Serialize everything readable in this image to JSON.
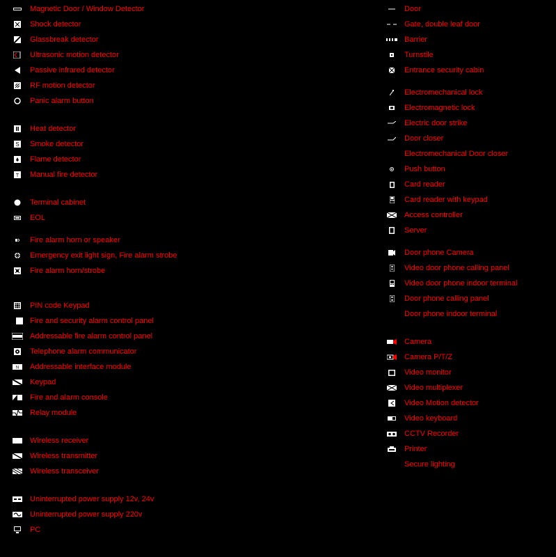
{
  "left": [
    {
      "icon": "magneticdoor",
      "label": "Magnetic Door / Window Detector"
    },
    {
      "icon": "shock",
      "label": "Shock detector"
    },
    {
      "icon": "glassbreak",
      "label": "Glassbreak detector"
    },
    {
      "icon": "ultrasonic",
      "label": "Ultrasonic motion detector"
    },
    {
      "icon": "pir",
      "label": "Passive infrared detector"
    },
    {
      "icon": "rfmotion",
      "label": "RF motion detector"
    },
    {
      "icon": "panic",
      "label": "Panic alarm button"
    },
    {
      "gap": "m"
    },
    {
      "icon": "heat",
      "label": "Heat detector"
    },
    {
      "icon": "smoke",
      "label": "Smoke detector"
    },
    {
      "icon": "flame",
      "label": "Flame detector"
    },
    {
      "icon": "manualfire",
      "label": "Manual fire detector"
    },
    {
      "gap": "m"
    },
    {
      "icon": "terminal",
      "label": "Terminal cabinet"
    },
    {
      "icon": "eol",
      "label": "EOL"
    },
    {
      "gap": "s"
    },
    {
      "icon": "horn",
      "label": "Fire alarm horn or speaker"
    },
    {
      "icon": "strobe",
      "label": "Emergency exit light sign, Fire alarm strobe"
    },
    {
      "icon": "hornstrobe",
      "label": "Fire alarm horn/strobe"
    },
    {
      "gap": "l"
    },
    {
      "icon": "pinkeypad",
      "label": "PIN code Keypad"
    },
    {
      "icon": "firesec",
      "label": "Fire and security alarm control panel"
    },
    {
      "icon": "addressable",
      "label": "Addressable fire alarm control panel"
    },
    {
      "icon": "telcomm",
      "label": "Telephone alarm communicator"
    },
    {
      "icon": "addrmod",
      "label": "Addressable interface module"
    },
    {
      "icon": "keypad",
      "label": "Keypad"
    },
    {
      "icon": "fireconsole",
      "label": "Fire and alarm console"
    },
    {
      "icon": "relay",
      "label": "Relay module"
    },
    {
      "gap": "m"
    },
    {
      "icon": "wlrx",
      "label": "Wireless receiver"
    },
    {
      "icon": "wltx",
      "label": "Wireless transmitter"
    },
    {
      "icon": "wltrx",
      "label": "Wireless transceiver"
    },
    {
      "gap": "m"
    },
    {
      "icon": "ups12",
      "label": "Uninterrupted power supply 12v, 24v"
    },
    {
      "icon": "ups220",
      "label": "Uninterrupted power supply 220v"
    },
    {
      "icon": "pc",
      "label": "PC"
    }
  ],
  "right": [
    {
      "icon": "door",
      "label": "Door"
    },
    {
      "icon": "gate",
      "label": "Gate, double leaf door"
    },
    {
      "icon": "barrier",
      "label": "Barrier"
    },
    {
      "icon": "turnstile",
      "label": "Turnstile"
    },
    {
      "icon": "seccabin",
      "label": "Entrance security cabin"
    },
    {
      "gap": "s"
    },
    {
      "icon": "emlock",
      "label": "Electromechanical lock"
    },
    {
      "icon": "maglock",
      "label": "Electromagnetic lock"
    },
    {
      "icon": "strike",
      "label": "Electric door strike"
    },
    {
      "icon": "closer",
      "label": "Door closer"
    },
    {
      "icon": "emcloser",
      "label": "Electromechanical Door closer"
    },
    {
      "icon": "pushbtn",
      "label": "Push button"
    },
    {
      "icon": "cardreader",
      "label": "Card reader"
    },
    {
      "icon": "cardreaderkp",
      "label": "Card reader with keypad"
    },
    {
      "icon": "accessctrl",
      "label": "Access controller"
    },
    {
      "icon": "server",
      "label": "Server"
    },
    {
      "gap": "s"
    },
    {
      "icon": "doorcam",
      "label": "Door phone Camera"
    },
    {
      "icon": "vdpcall",
      "label": "Video door phone calling panel"
    },
    {
      "icon": "vdpterm",
      "label": "Video door phone indoor terminal"
    },
    {
      "icon": "dpcall",
      "label": "Door phone calling panel"
    },
    {
      "icon": "dpterm",
      "label": "Door phone indoor terminal"
    },
    {
      "gap": "m"
    },
    {
      "icon": "camera",
      "label": "Camera"
    },
    {
      "icon": "cameraptz",
      "label": "Camera P/T/Z"
    },
    {
      "icon": "vmonitor",
      "label": "Video monitor"
    },
    {
      "icon": "vmux",
      "label": "Video multiplexer"
    },
    {
      "icon": "vmotion",
      "label": "Video Motion detector"
    },
    {
      "icon": "vkeyb",
      "label": "Video keyboard"
    },
    {
      "icon": "cctvrec",
      "label": "CCTV Recorder"
    },
    {
      "icon": "printer",
      "label": "Printer"
    },
    {
      "icon": "lighting",
      "label": "Secure lighting"
    }
  ]
}
